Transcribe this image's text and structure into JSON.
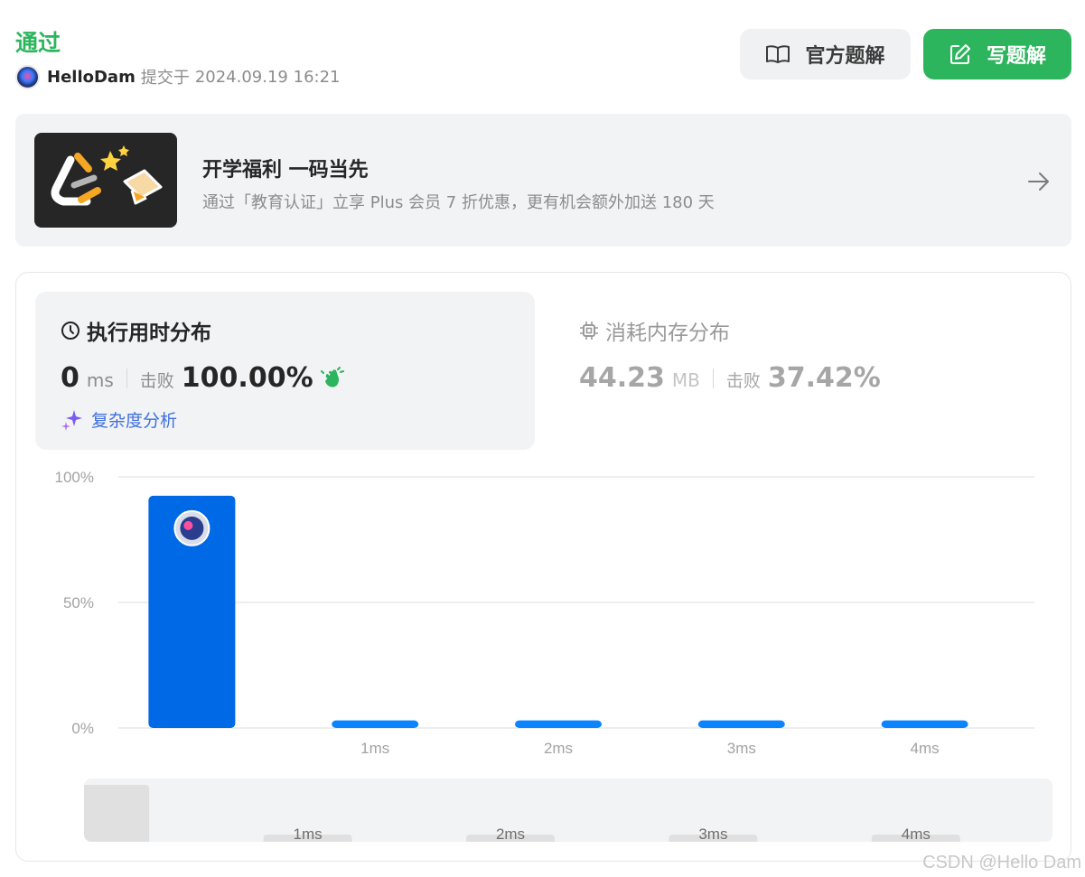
{
  "submission": {
    "status": "通过",
    "username": "HelloDam",
    "submitted_label": "提交于",
    "submitted_time": "2024.09.19 16:21"
  },
  "actions": {
    "official_solution_label": "官方题解",
    "write_solution_label": "写题解"
  },
  "promo": {
    "title": "开学福利 一码当先",
    "subtitle": "通过「教育认证」立享 Plus 会员 7 折优惠，更有机会额外加送 180 天"
  },
  "runtime": {
    "title": "执行用时分布",
    "value": "0",
    "unit": "ms",
    "beat_label": "击败",
    "beat_percent": "100.00%",
    "complexity_link": "复杂度分析"
  },
  "memory": {
    "title": "消耗内存分布",
    "value": "44.23",
    "unit": "MB",
    "beat_label": "击败",
    "beat_percent": "37.42%"
  },
  "chart_data": {
    "type": "bar",
    "categories": [
      "",
      "1ms",
      "2ms",
      "3ms",
      "4ms"
    ],
    "values": [
      92.5,
      3,
      3,
      3,
      3
    ],
    "y_ticks": [
      "100%",
      "50%",
      "0%"
    ],
    "ylim": [
      0,
      100
    ],
    "highlight_index": 0,
    "grid": true,
    "colors": {
      "highlight": "#0069e6",
      "bar": "#0a84ff",
      "grid": "#e8e8e8"
    }
  },
  "brush": {
    "labels": [
      "1ms",
      "2ms",
      "3ms",
      "4ms"
    ],
    "values": [
      92.5,
      3,
      3,
      3,
      3
    ]
  },
  "watermark": "CSDN @Hello Dam",
  "colors": {
    "accent": "#2db55d",
    "link": "#3f6fe0",
    "panel": "#f2f3f5"
  }
}
